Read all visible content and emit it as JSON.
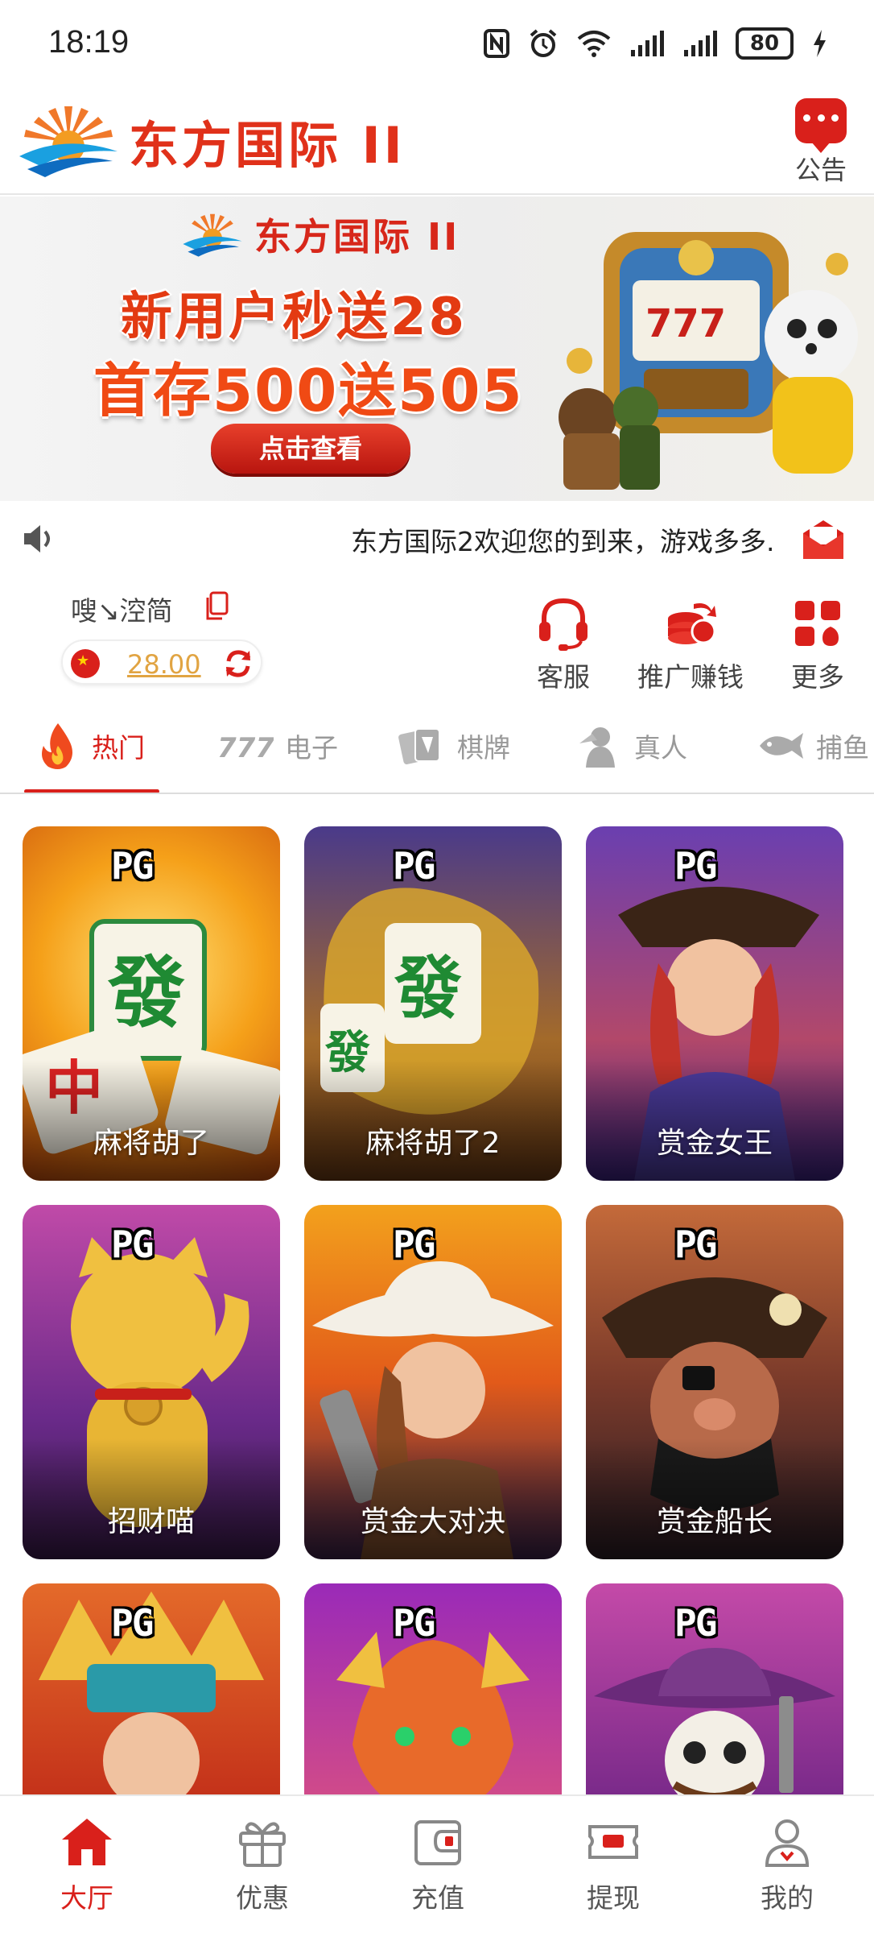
{
  "status_bar": {
    "time": "18:19",
    "battery": "80"
  },
  "header": {
    "brand": "东方国际 II",
    "notice_label": "公告"
  },
  "banner": {
    "brand": "东方国际 II",
    "line1": "新用户秒送28",
    "line2": "首存500送505",
    "cta": "点击查看"
  },
  "marquee": {
    "text": "东方国际2欢迎您的到来，游戏多多."
  },
  "account": {
    "username": "嗖↘涳简",
    "balance": "28.00"
  },
  "quick_actions": [
    {
      "label": "客服",
      "icon": "headset-icon"
    },
    {
      "label": "推广赚钱",
      "icon": "coins-share-icon"
    },
    {
      "label": "更多",
      "icon": "grid-more-icon"
    }
  ],
  "tabs": [
    {
      "label": "热门",
      "icon": "fire-icon",
      "active": true
    },
    {
      "label": "电子",
      "icon": "slot-777-icon",
      "active": false
    },
    {
      "label": "棋牌",
      "icon": "cards-icon",
      "active": false
    },
    {
      "label": "真人",
      "icon": "dealer-icon",
      "active": false
    },
    {
      "label": "捕鱼",
      "icon": "fish-icon",
      "active": false
    }
  ],
  "games": [
    {
      "title": "麻将胡了",
      "badge": "PG"
    },
    {
      "title": "麻将胡了2",
      "badge": "PG"
    },
    {
      "title": "赏金女王",
      "badge": "PG"
    },
    {
      "title": "招财喵",
      "badge": "PG"
    },
    {
      "title": "赏金大对决",
      "badge": "PG"
    },
    {
      "title": "赏金船长",
      "badge": "PG"
    },
    {
      "title": "",
      "badge": "PG"
    },
    {
      "title": "",
      "badge": "PG"
    },
    {
      "title": "",
      "badge": "PG"
    }
  ],
  "bottom_nav": [
    {
      "label": "大厅",
      "icon": "home-icon",
      "active": true
    },
    {
      "label": "优惠",
      "icon": "gift-icon",
      "active": false
    },
    {
      "label": "充值",
      "icon": "wallet-icon",
      "active": false
    },
    {
      "label": "提现",
      "icon": "ticket-icon",
      "active": false
    },
    {
      "label": "我的",
      "icon": "user-icon",
      "active": false
    }
  ],
  "colors": {
    "brand_red": "#d9201b",
    "balance_gold": "#e1a442"
  }
}
